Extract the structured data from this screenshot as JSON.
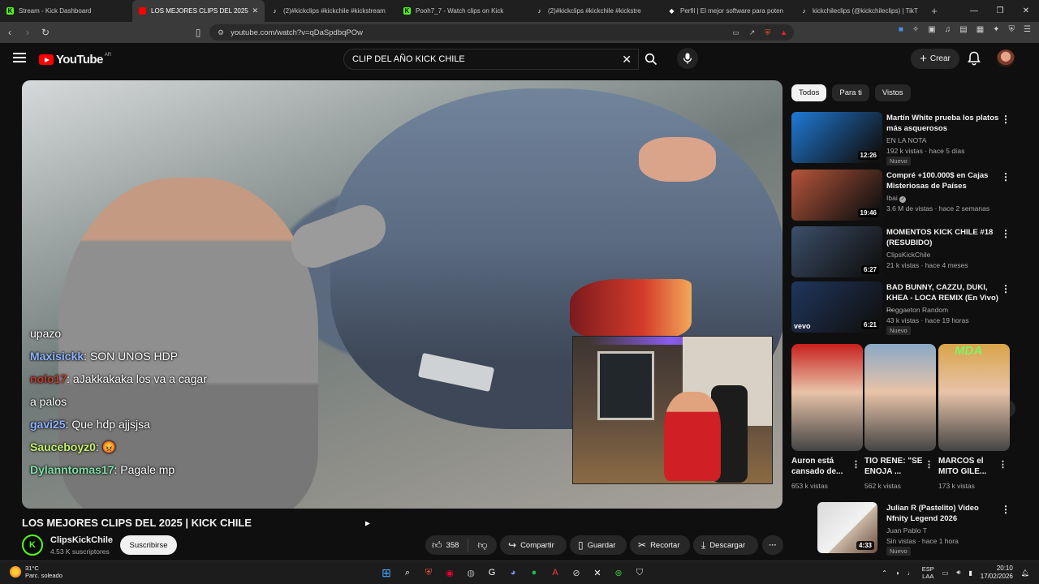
{
  "browser": {
    "tabs": [
      {
        "title": "Stream - Kick Dashboard",
        "color": "#53fc18",
        "glyph": "K",
        "active": false
      },
      {
        "title": "LOS MEJORES CLIPS DEL 2025",
        "color": "#ff0000",
        "glyph": "▶",
        "active": true
      },
      {
        "title": "(2)#kickclips #kickchile #kickstream",
        "color": "#ffffff",
        "glyph": "♪",
        "active": false
      },
      {
        "title": "Pooh7_7 - Watch clips on Kick",
        "color": "#53fc18",
        "glyph": "K",
        "active": false
      },
      {
        "title": "(2)#kickclips #kickchile #kickstre",
        "color": "#ffffff",
        "glyph": "♪",
        "active": false
      },
      {
        "title": "Perfil | El mejor software para poten",
        "color": "#ffffff",
        "glyph": "◆",
        "active": false
      },
      {
        "title": "kickchileclips (@kickchileclips) | TikT",
        "color": "#ffffff",
        "glyph": "♪",
        "active": false
      }
    ],
    "url": "youtube.com/watch?v=qDaSpdbqPOw"
  },
  "youtube": {
    "logo_text": "YouTube",
    "region": "AR",
    "search_value": "CLIP DEL AÑO KICK CHILE",
    "create_label": "Crear"
  },
  "video": {
    "title": "LOS MEJORES CLIPS DEL 2025 | KICK CHILE",
    "chat": [
      {
        "user": "",
        "user_color": "#ffffff",
        "text": "upazo"
      },
      {
        "user": "Maxisickk",
        "user_color": "#8fb3ff",
        "text": ": SON UNOS HDP"
      },
      {
        "user": "nolo17",
        "user_color": "#c0392b",
        "text": ": aJakkakaka los va a cagar"
      },
      {
        "user": "",
        "user_color": "#ffffff",
        "text": "a palos"
      },
      {
        "user": "gavi25",
        "user_color": "#8fb3ff",
        "text": ": Que hdp ajjsjsa"
      },
      {
        "user": "Sauceboyz0",
        "user_color": "#c6f26a",
        "text": ": 😡"
      },
      {
        "user": "Dylanntomas17",
        "user_color": "#7de0a6",
        "text": ": Pagale mp"
      }
    ],
    "channel": {
      "name": "ClipsKickChile",
      "subs": "4.53 K suscriptores",
      "avatar_letter": "K"
    },
    "subscribe_label": "Suscribirse",
    "likes": "358",
    "share_label": "Compartir",
    "save_label": "Guardar",
    "clip_label": "Recortar",
    "download_label": "Descargar"
  },
  "chips": [
    "Todos",
    "Para ti",
    "Vistos"
  ],
  "recommendations": [
    {
      "title": "Martín White prueba los platos más asquerosos",
      "channel": "EN LA NOTA",
      "meta": "192 k vistas · hace 5 días",
      "duration": "12:26",
      "badge": "Nuevo",
      "thumb": "#1f7ad6",
      "verified": false
    },
    {
      "title": "Compré +100.000$ en Cajas Misteriosas de Países",
      "channel": "Ibai",
      "meta": "3.6 M de vistas · hace 2 semanas",
      "duration": "19:46",
      "badge": "",
      "thumb": "#b8553a",
      "verified": true
    },
    {
      "title": "MOMENTOS KICK CHILE #18 (RESUBIDO)",
      "channel": "ClipsKickChile",
      "meta": "21 k vistas · hace 4 meses",
      "duration": "6:27",
      "badge": "",
      "thumb": "#3c4f6b",
      "verified": false
    },
    {
      "title": "BAD BUNNY, CAZZU, DUKI, KHEA - LOCA REMIX (En Vivo) ...",
      "channel": "Reggaeton Random",
      "meta": "43 k vistas · hace 19 horas",
      "duration": "6:21",
      "badge": "Nuevo",
      "thumb": "#20365f",
      "verified": false,
      "vevo": "vevo"
    }
  ],
  "shorts": [
    {
      "title": "Auron está cansado de...",
      "views": "653 k vistas",
      "thumb": "#c8201d"
    },
    {
      "title": "TIO RENE: \"SE ENOJA ...",
      "views": "562 k vistas",
      "thumb": "#8aa9c6"
    },
    {
      "title": "MARCOS el MITO GILE...",
      "views": "173 k vistas",
      "thumb": "#d9a449",
      "overlay": "MDA"
    }
  ],
  "last_reco": {
    "title": "Julian R (Pastelito) Video Nfnity Legend 2026",
    "channel": "Juan Pablo T",
    "meta": "Sin vistas · hace 1 hora",
    "duration": "4:33",
    "badge": "Nuevo"
  },
  "taskbar": {
    "temp": "31°C",
    "weather": "Parc. soleado",
    "lang1": "ESP",
    "lang2": "LAA",
    "time": "20:10",
    "date": "17/02/2026"
  }
}
